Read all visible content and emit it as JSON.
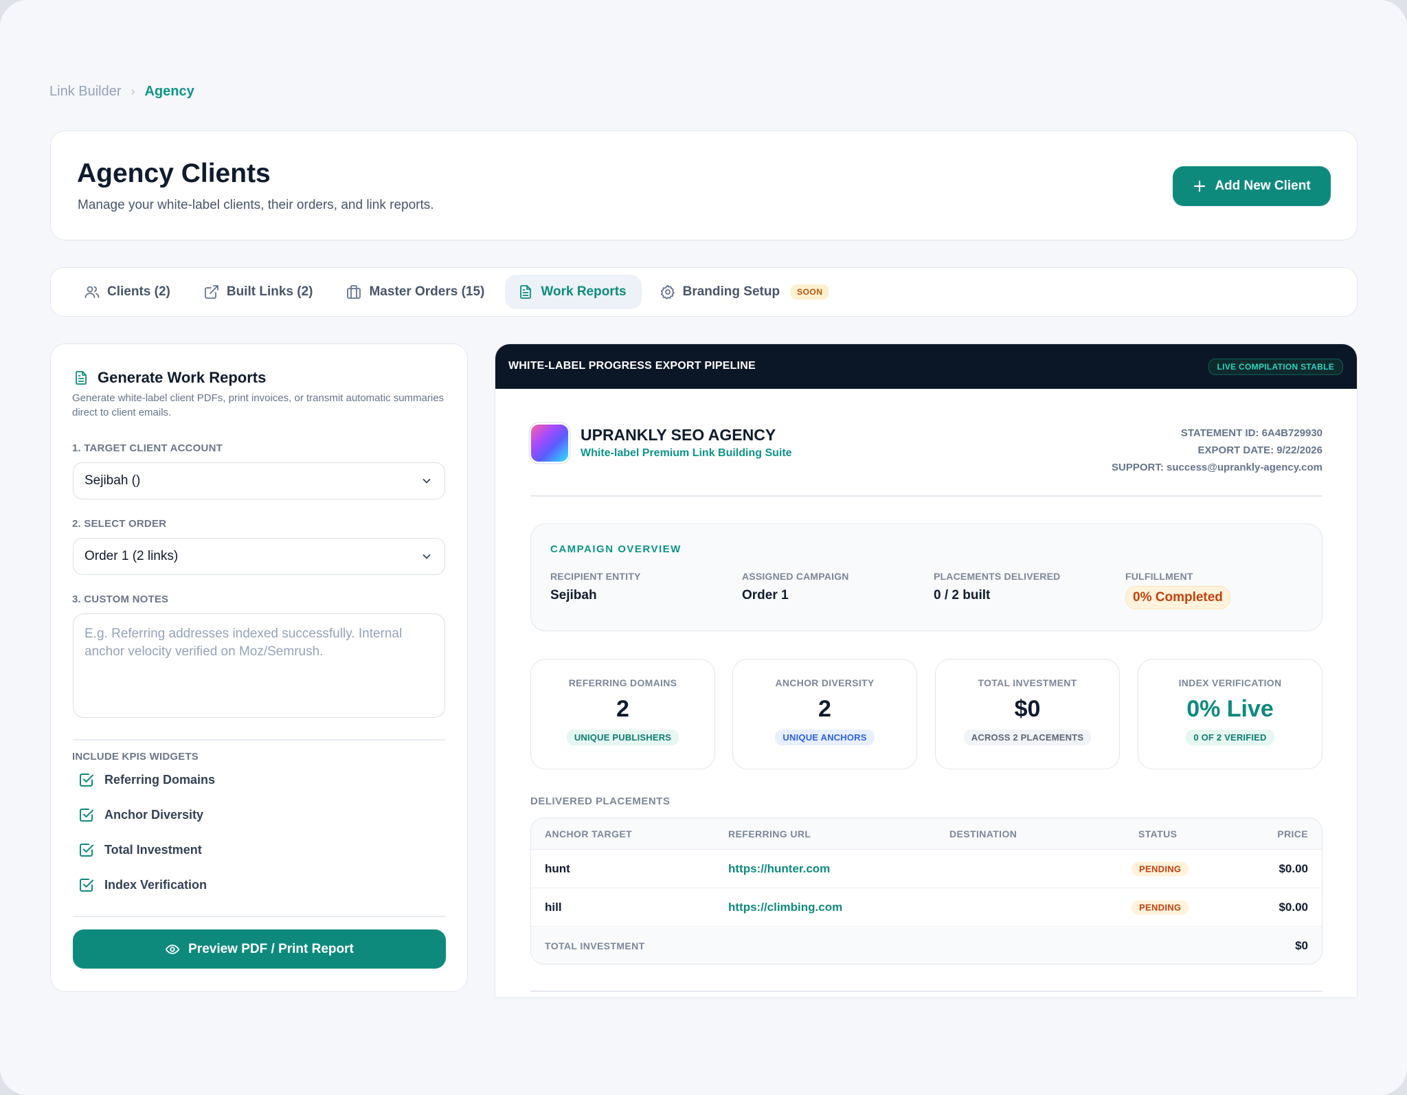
{
  "breadcrumb": {
    "parent": "Link Builder",
    "separator": "›",
    "current": "Agency"
  },
  "header": {
    "title": "Agency Clients",
    "subtitle": "Manage your white-label clients, their orders, and link reports.",
    "add_button": "Add New Client"
  },
  "tabs": [
    {
      "label": "Clients (2)",
      "icon": "users-icon"
    },
    {
      "label": "Built Links (2)",
      "icon": "external-link-icon"
    },
    {
      "label": "Master Orders (15)",
      "icon": "briefcase-icon"
    },
    {
      "label": "Work Reports",
      "icon": "document-icon",
      "active": true
    },
    {
      "label": "Branding Setup",
      "icon": "gear-icon",
      "badge": "SOON"
    }
  ],
  "generator": {
    "title": "Generate Work Reports",
    "description": "Generate white-label client PDFs, print invoices, or transmit automatic summaries direct to client emails.",
    "client_label": "1. TARGET CLIENT ACCOUNT",
    "client_value": "Sejibah ()",
    "order_label": "2. SELECT ORDER",
    "order_value": "Order 1 (2 links)",
    "notes_label": "3. CUSTOM NOTES",
    "notes_placeholder": "E.g. Referring addresses indexed successfully. Internal anchor velocity verified on Moz/Semrush.",
    "kpis_label": "INCLUDE KPIS WIDGETS",
    "kpis": [
      "Referring Domains",
      "Anchor Diversity",
      "Total Investment",
      "Index Verification"
    ],
    "preview_button": "Preview PDF / Print Report"
  },
  "preview": {
    "pipeline_title": "WHITE-LABEL PROGRESS EXPORT PIPELINE",
    "live_badge": "LIVE COMPILATION STABLE",
    "agency_name": "UPRANKLY SEO AGENCY",
    "agency_tagline": "White-label Premium Link Building Suite",
    "statement_id": "STATEMENT ID: 6A4B729930",
    "export_date": "EXPORT DATE: 9/22/2026",
    "support": "SUPPORT: success@uprankly-agency.com",
    "overview": {
      "title": "CAMPAIGN OVERVIEW",
      "recipient_label": "RECIPIENT ENTITY",
      "recipient_value": "Sejibah",
      "campaign_label": "ASSIGNED CAMPAIGN",
      "campaign_value": "Order 1",
      "placements_label": "PLACEMENTS DELIVERED",
      "placements_value": "0 / 2 built",
      "fulfillment_label": "FULFILLMENT",
      "fulfillment_value": "0% Completed"
    },
    "kpi_cards": [
      {
        "label": "REFERRING DOMAINS",
        "value": "2",
        "sub": "UNIQUE PUBLISHERS"
      },
      {
        "label": "ANCHOR DIVERSITY",
        "value": "2",
        "sub": "UNIQUE ANCHORS"
      },
      {
        "label": "TOTAL INVESTMENT",
        "value": "$0",
        "sub": "ACROSS 2 PLACEMENTS"
      },
      {
        "label": "INDEX VERIFICATION",
        "value": "0% Live",
        "sub": "0 OF 2 VERIFIED"
      }
    ],
    "placements_title": "DELIVERED PLACEMENTS",
    "table": {
      "headers": [
        "ANCHOR TARGET",
        "REFERRING URL",
        "DESTINATION",
        "STATUS",
        "PRICE"
      ],
      "rows": [
        {
          "anchor": "hunt",
          "url": "https://hunter.com",
          "destination": "",
          "status": "PENDING",
          "price": "$0.00"
        },
        {
          "anchor": "hill",
          "url": "https://climbing.com",
          "destination": "",
          "status": "PENDING",
          "price": "$0.00"
        }
      ],
      "total_label": "TOTAL INVESTMENT",
      "total_value": "$0"
    }
  },
  "colors": {
    "accent": "#0e8a7d",
    "dark_bar": "#0b1727",
    "pending": "#c2410c"
  }
}
